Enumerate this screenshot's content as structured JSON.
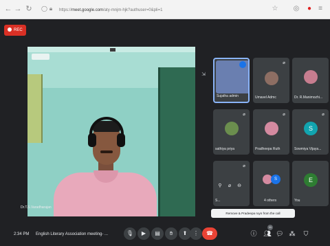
{
  "browser": {
    "url_host": "meet.google.com",
    "url_prefix": "https://",
    "url_suffix": "/aty-mnjm-hjk?authuser=0&pli=1"
  },
  "meet": {
    "rec_label": "REC",
    "presenter_name": "Dr.T.S.Varadharajan"
  },
  "tiles": [
    {
      "name": "Sujatha admin",
      "kind": "video"
    },
    {
      "name": "Umavel Admc",
      "kind": "video"
    },
    {
      "name": "Dr. R.Manimozhi...",
      "kind": "video"
    },
    {
      "name": "sathiya priya",
      "kind": "video"
    },
    {
      "name": "Pradheepa Ruth",
      "kind": "video"
    },
    {
      "name": "Sowmiya Vijaya...",
      "kind": "avatar",
      "initial": "S",
      "color": "#12a4af"
    },
    {
      "name": "S...",
      "kind": "hover"
    },
    {
      "name": "4 others",
      "kind": "group",
      "initial": "S",
      "color": "#1a73e8"
    },
    {
      "name": "You",
      "kind": "avatar",
      "initial": "E",
      "color": "#2e7d32"
    }
  ],
  "tooltip": "Remove & Pradeepa ruyn from the call",
  "toolbar": {
    "time": "2:34 PM",
    "meeting_title": "English Literary Association meeting- ...",
    "participant_count": "11"
  },
  "colors": {
    "meet_background": "#202124",
    "end_call": "#ea4335",
    "rec": "#d93025"
  }
}
